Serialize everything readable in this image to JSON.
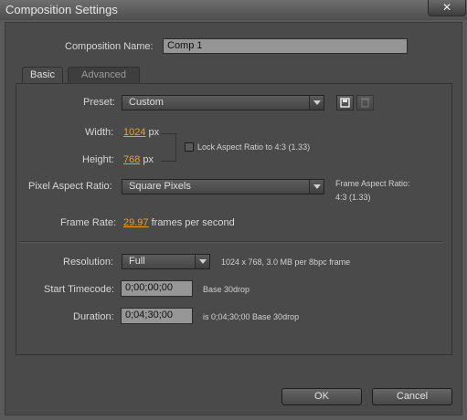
{
  "window": {
    "title": "Composition Settings",
    "close_label": "✕"
  },
  "comp_name": {
    "label": "Composition Name:",
    "value": "Comp 1"
  },
  "tabs": [
    {
      "label": "Basic",
      "active": true
    },
    {
      "label": "Advanced",
      "active": false
    }
  ],
  "preset": {
    "label": "Preset:",
    "value": "Custom",
    "save_icon": "save-preset-icon",
    "delete_icon": "trash-icon"
  },
  "width": {
    "label": "Width:",
    "value": "1024",
    "unit": "px"
  },
  "height": {
    "label": "Height:",
    "value": "768",
    "unit": "px"
  },
  "lock_aspect": {
    "label": "Lock Aspect Ratio to 4:3 (1.33)",
    "checked": false
  },
  "pixel_aspect": {
    "label": "Pixel Aspect Ratio:",
    "value": "Square Pixels",
    "frame_aspect_label": "Frame Aspect Ratio:",
    "frame_aspect_value": "4:3 (1.33)"
  },
  "frame_rate": {
    "label": "Frame Rate:",
    "value": "29.97",
    "suffix": "frames per second"
  },
  "resolution": {
    "label": "Resolution:",
    "value": "Full",
    "info": "1024 x 768, 3.0 MB per 8bpc frame"
  },
  "start_timecode": {
    "label": "Start Timecode:",
    "value": "0;00;00;00",
    "note": "Base 30drop"
  },
  "duration": {
    "label": "Duration:",
    "value": "0;04;30;00",
    "note": "is 0;04;30;00  Base 30drop"
  },
  "buttons": {
    "ok": "OK",
    "cancel": "Cancel"
  },
  "colors": {
    "accent_value": "#e8a12a",
    "background": "#4a4a4a",
    "field": "#969696"
  }
}
